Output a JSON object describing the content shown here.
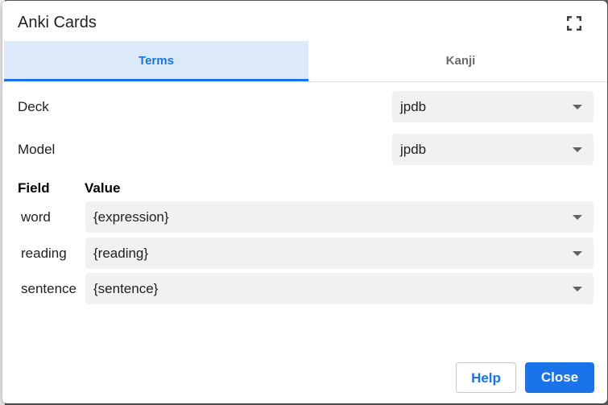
{
  "dialog": {
    "title": "Anki Cards",
    "fullscreen_icon": "fullscreen-icon"
  },
  "tabs": [
    {
      "label": "Terms",
      "active": true
    },
    {
      "label": "Kanji",
      "active": false
    }
  ],
  "deck": {
    "label": "Deck",
    "value": "jpdb"
  },
  "model": {
    "label": "Model",
    "value": "jpdb"
  },
  "fields": {
    "header_field": "Field",
    "header_value": "Value",
    "rows": [
      {
        "field": "word",
        "value": "{expression}"
      },
      {
        "field": "reading",
        "value": "{reading}"
      },
      {
        "field": "sentence",
        "value": "{sentence}"
      }
    ]
  },
  "buttons": {
    "help": "Help",
    "close": "Close"
  },
  "colors": {
    "accent": "#1a73e8",
    "active_tab_bg": "#dbe9f9",
    "select_bg": "#f1f1f1"
  }
}
